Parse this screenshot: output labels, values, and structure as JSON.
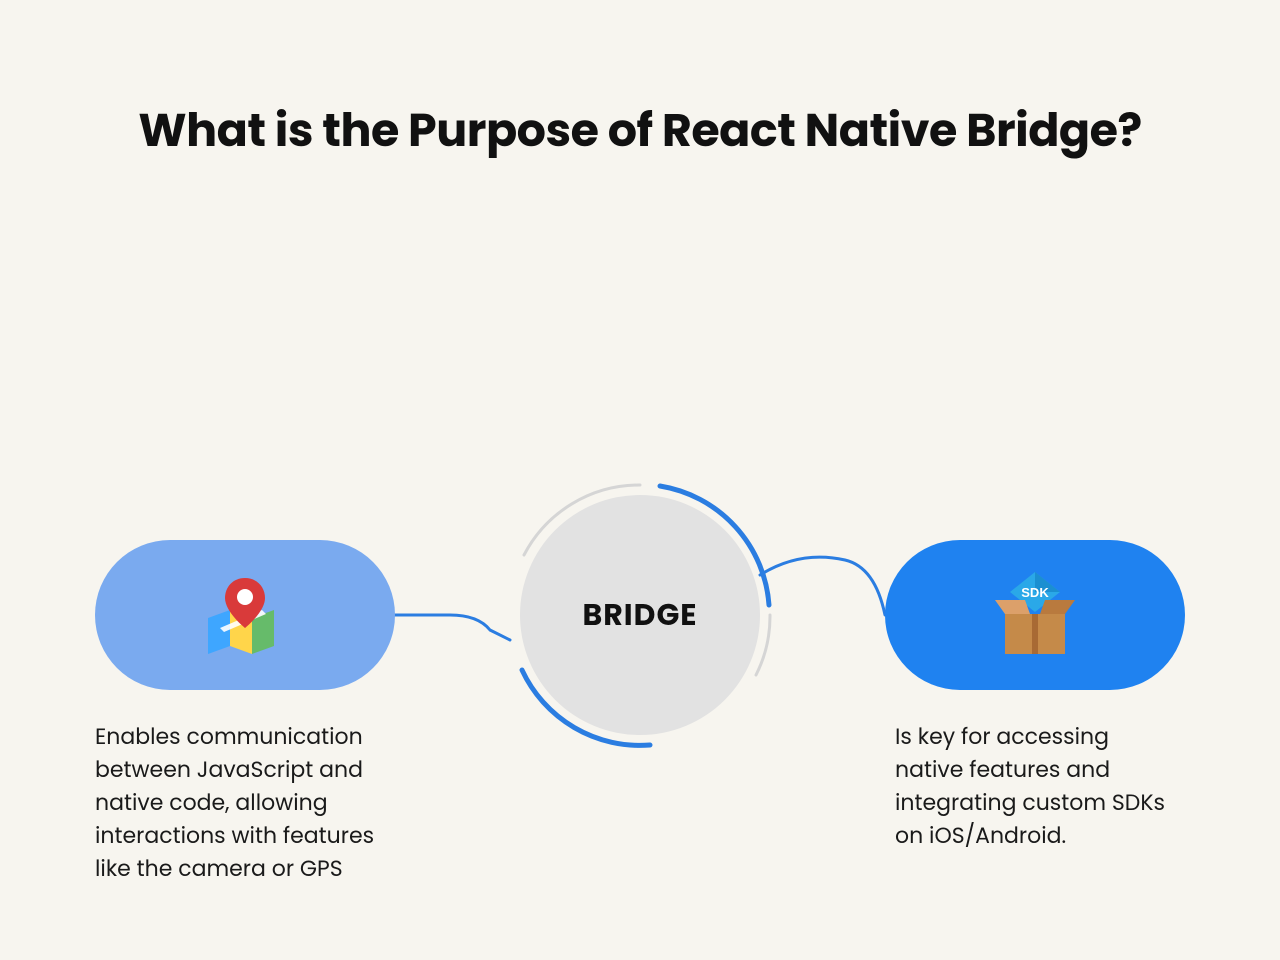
{
  "title": "What is the Purpose of React Native Bridge?",
  "hub": {
    "label": "BRIDGE"
  },
  "left": {
    "icon": "map-pin-icon",
    "description": "Enables communication between JavaScript and native code, allowing interactions with features like the camera or GPS"
  },
  "right": {
    "icon": "sdk-box-icon",
    "description": "Is key for accessing native features and integrating custom SDKs on iOS/Android."
  },
  "sdk_badge_text": "SDK",
  "colors": {
    "bg": "#f7f5ef",
    "pill_left": "#7aaaef",
    "pill_right": "#1f82f0",
    "circle": "#e2e2e2",
    "accent_blue": "#2b7de1"
  }
}
